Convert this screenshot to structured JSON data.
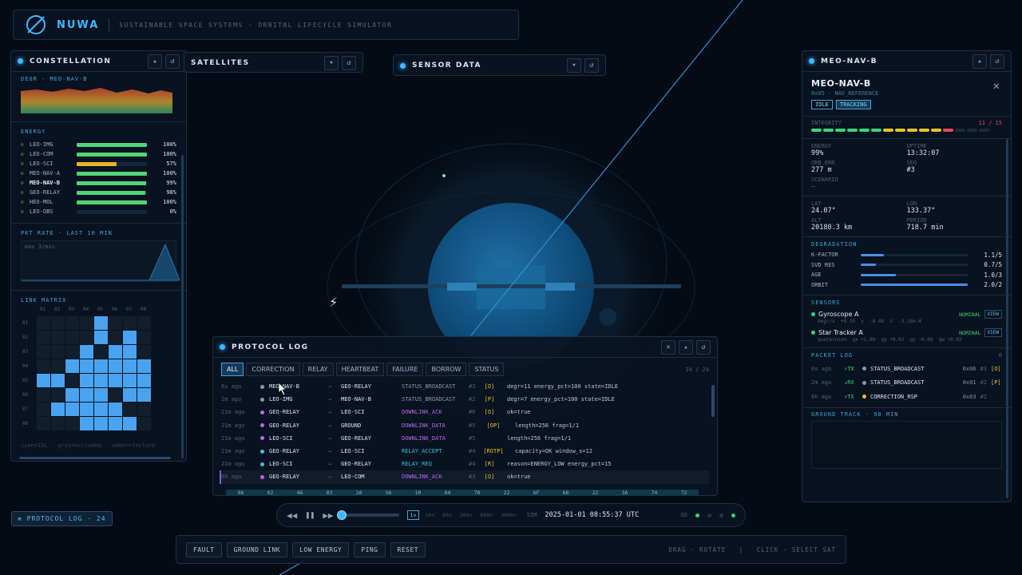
{
  "header": {
    "brand": "NUWA",
    "tagline": "SUSTAINABLE SPACE SYSTEMS · ORBITAL LIFECYCLE SIMULATOR"
  },
  "constellation": {
    "title": "CONSTELLATION",
    "degr_label": "DEGR · MEO-NAV-B",
    "energy_label": "ENERGY",
    "energy": [
      {
        "name": "LEO-IMG",
        "pct": "100%",
        "value": 100,
        "color": "#54d27a",
        "bold": false
      },
      {
        "name": "LEO-COM",
        "pct": "100%",
        "value": 100,
        "color": "#54d27a",
        "bold": false
      },
      {
        "name": "LEO-SCI",
        "pct": "57%",
        "value": 57,
        "color": "#e6b52e",
        "bold": false
      },
      {
        "name": "MEO-NAV-A",
        "pct": "100%",
        "value": 100,
        "color": "#54d27a",
        "bold": false
      },
      {
        "name": "MEO-NAV-B",
        "pct": "99%",
        "value": 99,
        "color": "#54d27a",
        "bold": true
      },
      {
        "name": "GEO-RELAY",
        "pct": "98%",
        "value": 98,
        "color": "#54d27a",
        "bold": false
      },
      {
        "name": "HEO-MOL",
        "pct": "100%",
        "value": 100,
        "color": "#54d27a",
        "bold": false
      },
      {
        "name": "LEO-OBS",
        "pct": "0%",
        "value": 0,
        "color": "#54d27a",
        "bold": false
      }
    ],
    "pkt_label": "PKT RATE · LAST 10 MIN",
    "pkt_max": "max 3/min",
    "link_label": "LINK MATRIX",
    "matrix_cols": [
      "01",
      "02",
      "03",
      "04",
      "05",
      "06",
      "07",
      "08"
    ],
    "matrix_rows": [
      "01",
      "02",
      "03",
      "04",
      "05",
      "06",
      "07",
      "08"
    ],
    "matrix": [
      [
        0,
        0,
        0,
        0,
        1,
        0,
        0,
        0
      ],
      [
        0,
        0,
        0,
        0,
        1,
        0,
        1,
        0
      ],
      [
        0,
        0,
        0,
        1,
        0,
        1,
        1,
        0
      ],
      [
        0,
        0,
        1,
        1,
        1,
        1,
        1,
        1
      ],
      [
        1,
        1,
        0,
        1,
        1,
        1,
        1,
        1
      ],
      [
        0,
        0,
        1,
        1,
        1,
        0,
        1,
        1
      ],
      [
        0,
        1,
        1,
        1,
        1,
        1,
        0,
        0
      ],
      [
        0,
        0,
        0,
        1,
        1,
        1,
        1,
        0
      ]
    ],
    "legend": "cyan=ISL · grey=occluded · amber=failure"
  },
  "satellites": {
    "title": "SATELLITES"
  },
  "sensor": {
    "title": "SENSOR DATA"
  },
  "detail": {
    "title": "MEO-NAV-B",
    "name": "MEO-NAV-B",
    "sub": "0x05 · NAV_REFERENCE",
    "tags": [
      "IDLE",
      "TRACKING"
    ],
    "integrity_label": "INTEGRITY",
    "integrity_val": "11 / 15",
    "integrity_segments": [
      "#3dd27a",
      "#3dd27a",
      "#3dd27a",
      "#3dd27a",
      "#3dd27a",
      "#3dd27a",
      "#e6c22e",
      "#e6c22e",
      "#e6c22e",
      "#e6c22e",
      "#e6c22e",
      "#e64a5a",
      "#1a2a3c",
      "#1a2a3c",
      "#1a2a3c"
    ],
    "energy_label": "ENERGY",
    "energy": "99%",
    "uptime_label": "UPTIME",
    "uptime": "13:32:07",
    "orberr_label": "ORB ERR",
    "orberr": "277 m",
    "seq_label": "SEQ",
    "seq": "#3",
    "scenario_label": "SCENARIO",
    "scenario": "—",
    "lat_label": "LAT",
    "lat": "24.07°",
    "lon_label": "LON",
    "lon": "133.37°",
    "alt_label": "ALT",
    "alt": "20180.3 km",
    "period_label": "PERIOD",
    "period": "718.7 min",
    "degr_label": "DEGRADATION",
    "degr": [
      {
        "name": "K-FACTOR",
        "val": "1.1/5",
        "value": 0.22
      },
      {
        "name": "SVD RES",
        "val": "0.7/5",
        "value": 0.14
      },
      {
        "name": "AGE",
        "val": "1.0/3",
        "value": 0.33
      },
      {
        "name": "ORBIT",
        "val": "2.0/2",
        "value": 1.0
      }
    ],
    "sensors_label": "SENSORS",
    "sensors": [
      {
        "name": "Gyroscope A",
        "status": "NOMINAL",
        "view": "VIEW",
        "readout": "degr/s  +0.35  y  -0.49  z  -3.18e-4"
      },
      {
        "name": "Star Tracker A",
        "status": "NOMINAL",
        "view": "VIEW",
        "readout": "quaternion  qx +1.00  qy +0.02  qz -0.08  qw +0.03"
      }
    ],
    "pktlog_label": "PACKET LOG",
    "pktlog_count": "6",
    "pktlog": [
      {
        "time": "6s ago",
        "dir": "↑TX",
        "dot": "#8a99a8",
        "msg": "STATUS_BROADCAST",
        "code": "0x06",
        "seq": "#3",
        "flag": "[O]"
      },
      {
        "time": "2m ago",
        "dir": "↓RX",
        "dot": "#8a99a8",
        "msg": "STATUS_BROADCAST",
        "code": "0x01",
        "seq": "#2",
        "flag": "[P]"
      },
      {
        "time": "6h ago",
        "dir": "↑TX",
        "dot": "#e6c22e",
        "msg": "CORRECTION_RSP",
        "code": "0x03",
        "seq": "#2",
        "flag": ""
      }
    ],
    "ground_label": "GROUND TRACK · 90 MIN"
  },
  "log": {
    "title": "PROTOCOL LOG",
    "filters": [
      "ALL",
      "CORRECTION",
      "RELAY",
      "HEARTBEAT",
      "FAILURE",
      "BORROW",
      "STATUS"
    ],
    "count": "24 / 24",
    "rows": [
      {
        "time": "6s ago",
        "dot": "#8a99a8",
        "src": "MEO-NAV-B",
        "dst": "GEO-RELAY",
        "type": "STATUS_BROADCAST",
        "tcolor": "#8a99a8",
        "seq": "#3",
        "flag": "[O]",
        "detail": "degr=11 energy_pct=100 state=IDLE"
      },
      {
        "time": "2m ago",
        "dot": "#8a99a8",
        "src": "LEO-IMG",
        "dst": "MEO-NAV-B",
        "type": "STATUS_BROADCAST",
        "tcolor": "#8a99a8",
        "seq": "#2",
        "flag": "[P]",
        "detail": "degr=7 energy_pct=100 state=IDLE"
      },
      {
        "time": "21m ago",
        "dot": "#b46ae6",
        "src": "GEO-RELAY",
        "dst": "LEO-SCI",
        "type": "DOWNLINK_ACK",
        "tcolor": "#b46ae6",
        "seq": "#6",
        "flag": "[O]",
        "detail": "ok=true"
      },
      {
        "time": "21m ago",
        "dot": "#b46ae6",
        "src": "GEO-RELAY",
        "dst": "GROUND",
        "type": "DOWNLINK_DATA",
        "tcolor": "#b46ae6",
        "seq": "#5",
        "flag": "[OP]",
        "detail": "length=256 frag=1/1"
      },
      {
        "time": "21m ago",
        "dot": "#b46ae6",
        "src": "LEO-SCI",
        "dst": "GEO-RELAY",
        "type": "DOWNLINK_DATA",
        "tcolor": "#b46ae6",
        "seq": "#5",
        "flag": "",
        "detail": "length=256 frag=1/1"
      },
      {
        "time": "21m ago",
        "dot": "#36c6d6",
        "src": "GEO-RELAY",
        "dst": "LEO-SCI",
        "type": "RELAY_ACCEPT",
        "tcolor": "#36c6d6",
        "seq": "#4",
        "flag": "[ROTP]",
        "detail": "capacity=OK window_s=12"
      },
      {
        "time": "21m ago",
        "dot": "#36c6d6",
        "src": "LEO-SCI",
        "dst": "GEO-RELAY",
        "type": "RELAY_REQ",
        "tcolor": "#36c6d6",
        "seq": "#4",
        "flag": "[R]",
        "detail": "reason=ENERGY_LOW energy_pct=15"
      },
      {
        "time": "6h ago",
        "dot": "#b46ae6",
        "src": "GEO-RELAY",
        "dst": "LEO-COM",
        "type": "DOWNLINK_ACK",
        "tcolor": "#b46ae6",
        "seq": "#3",
        "flag": "[O]",
        "detail": "ok=true"
      }
    ],
    "hex": [
      "06",
      "02",
      "46",
      "03",
      "2A",
      "56",
      "10",
      "04",
      "70",
      "22",
      "6F",
      "68",
      "22",
      "3A",
      "74",
      "72"
    ]
  },
  "badge": "≡ PROTOCOL LOG · 24",
  "playback": {
    "speeds": [
      "1×",
      "10×",
      "60×",
      "300×",
      "600×",
      "3600×"
    ],
    "active_speed": 0,
    "mode": "SIM",
    "datetime": "2025-01-01 08:55:37 UTC",
    "gs": "GS",
    "progress": 0
  },
  "actions": {
    "buttons": [
      "FAULT",
      "GROUND LINK",
      "LOW ENERGY",
      "PING",
      "RESET"
    ],
    "hint": "DRAG · ROTATE   |   CLICK · SELECT SAT"
  }
}
